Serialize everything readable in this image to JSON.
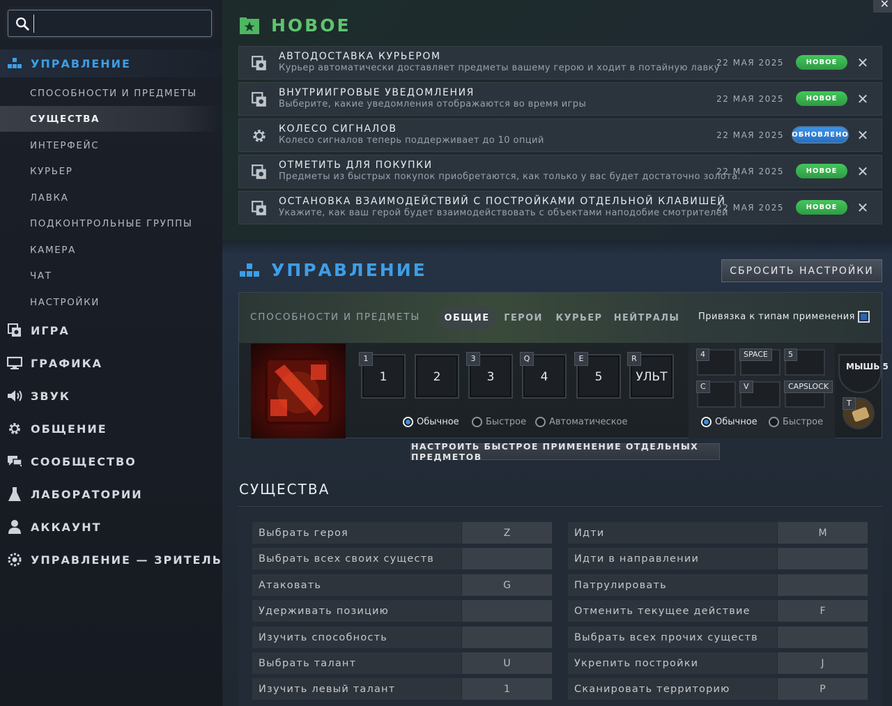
{
  "search": {
    "value": "",
    "placeholder": ""
  },
  "sidebar": {
    "items": [
      {
        "label": "УПРАВЛЕНИЕ",
        "icon": "controls-icon",
        "active": true
      },
      {
        "label": "ИГРА",
        "icon": "game-icon"
      },
      {
        "label": "ГРАФИКА",
        "icon": "monitor-icon"
      },
      {
        "label": "ЗВУК",
        "icon": "speaker-icon"
      },
      {
        "label": "ОБЩЕНИЕ",
        "icon": "gear-icon"
      },
      {
        "label": "СООБЩЕСТВО",
        "icon": "chat-icon"
      },
      {
        "label": "ЛАБОРАТОРИИ",
        "icon": "flask-icon"
      },
      {
        "label": "АККАУНТ",
        "icon": "user-icon"
      },
      {
        "label": "УПРАВЛЕНИЕ — ЗРИТЕЛЬ",
        "icon": "eye-gear-icon"
      }
    ],
    "subitems": [
      {
        "label": "СПОСОБНОСТИ И ПРЕДМЕТЫ"
      },
      {
        "label": "СУЩЕСТВА",
        "selected": true
      },
      {
        "label": "ИНТЕРФЕЙС"
      },
      {
        "label": "КУРЬЕР"
      },
      {
        "label": "ЛАВКА"
      },
      {
        "label": "ПОДКОНТРОЛЬНЫЕ ГРУППЫ"
      },
      {
        "label": "КАМЕРА"
      },
      {
        "label": "ЧАТ"
      },
      {
        "label": "НАСТРОЙКИ"
      }
    ]
  },
  "new_section": {
    "title": "НОВОЕ",
    "updates": [
      {
        "title": "АВТОДОСТАВКА КУРЬЕРОМ",
        "desc": "Курьер автоматически доставляет предметы вашему герою и ходит в потайную лавку",
        "date": "22 МАЯ 2025",
        "badge": "НОВОЕ",
        "badge_type": "new"
      },
      {
        "title": "ВНУТРИИГРОВЫЕ УВЕДОМЛЕНИЯ",
        "desc": "Выберите, какие уведомления отображаются во время игры",
        "date": "22 МАЯ 2025",
        "badge": "НОВОЕ",
        "badge_type": "new"
      },
      {
        "title": "КОЛЕСО СИГНАЛОВ",
        "desc": "Колесо сигналов теперь поддерживает до 10 опций",
        "date": "22 МАЯ 2025",
        "badge": "ОБНОВЛЕНО",
        "badge_type": "updated"
      },
      {
        "title": "ОТМЕТИТЬ ДЛЯ ПОКУПКИ",
        "desc": "Предметы из быстрых покупок приобретаются, как только у вас будет достаточно золота.",
        "date": "22 МАЯ 2025",
        "badge": "НОВОЕ",
        "badge_type": "new"
      },
      {
        "title": "ОСТАНОВКА ВЗАИМОДЕЙСТВИЙ С ПОСТРОЙКАМИ ОТДЕЛЬНОЙ КЛАВИШЕЙ",
        "desc": "Укажите, как ваш герой будет взаимодействовать с объектами наподобие смотрителей",
        "date": "22 МАЯ 2025",
        "badge": "НОВОЕ",
        "badge_type": "new"
      }
    ]
  },
  "controls": {
    "title": "УПРАВЛЕНИЕ",
    "reset_label": "СБРОСИТЬ НАСТРОЙКИ",
    "tab_section_label": "СПОСОБНОСТИ И ПРЕДМЕТЫ",
    "tabs": [
      "ОБЩИЕ",
      "ГЕРОИ",
      "КУРЬЕР",
      "НЕЙТРАЛЫ"
    ],
    "active_tab": "ОБЩИЕ",
    "bind_to_types_label": "Привязка к типам применения",
    "bind_to_types_checked": true,
    "ability_keys": [
      {
        "hotkey": "1",
        "label": "1"
      },
      {
        "hotkey": "",
        "label": "2"
      },
      {
        "hotkey": "3",
        "label": "3"
      },
      {
        "hotkey": "Q",
        "label": "4"
      },
      {
        "hotkey": "E",
        "label": "5"
      },
      {
        "hotkey": "R",
        "label": "УЛЬТ"
      }
    ],
    "cast_modes": [
      "Обычное",
      "Быстрое",
      "Автоматическое"
    ],
    "cast_mode_selected": "Обычное",
    "item_keys": [
      "4",
      "SPACE",
      "5",
      "C",
      "V",
      "CAPSLOCK"
    ],
    "item_cast_modes": [
      "Обычное",
      "Быстрое"
    ],
    "item_cast_selected": "Обычное",
    "mouse_key": "МЫШЬ 5",
    "tp_key": "T",
    "customize_label": "НАСТРОИТЬ БЫСТРОЕ ПРИМЕНЕНИЕ ОТДЕЛЬНЫХ ПРЕДМЕТОВ"
  },
  "creatures": {
    "title": "СУЩЕСТВА",
    "left": [
      {
        "action": "Выбрать героя",
        "key": "Z"
      },
      {
        "action": "Выбрать всех своих существ",
        "key": ""
      },
      {
        "action": "Атаковать",
        "key": "G"
      },
      {
        "action": "Удерживать позицию",
        "key": ""
      },
      {
        "action": "Изучить способность",
        "key": ""
      },
      {
        "action": "Выбрать талант",
        "key": "U"
      },
      {
        "action": "Изучить левый талант",
        "key": "1"
      }
    ],
    "right": [
      {
        "action": "Идти",
        "key": "M"
      },
      {
        "action": "Идти в направлении",
        "key": ""
      },
      {
        "action": "Патрулировать",
        "key": ""
      },
      {
        "action": "Отменить текущее действие",
        "key": "F"
      },
      {
        "action": "Выбрать всех прочих существ",
        "key": ""
      },
      {
        "action": "Укрепить постройки",
        "key": "J"
      },
      {
        "action": "Сканировать территорию",
        "key": "P"
      }
    ]
  },
  "colors": {
    "accent_blue": "#3e9ee6",
    "accent_green": "#5dc56f",
    "badge_new": "#3bb552",
    "badge_updated": "#2f7fd4"
  }
}
